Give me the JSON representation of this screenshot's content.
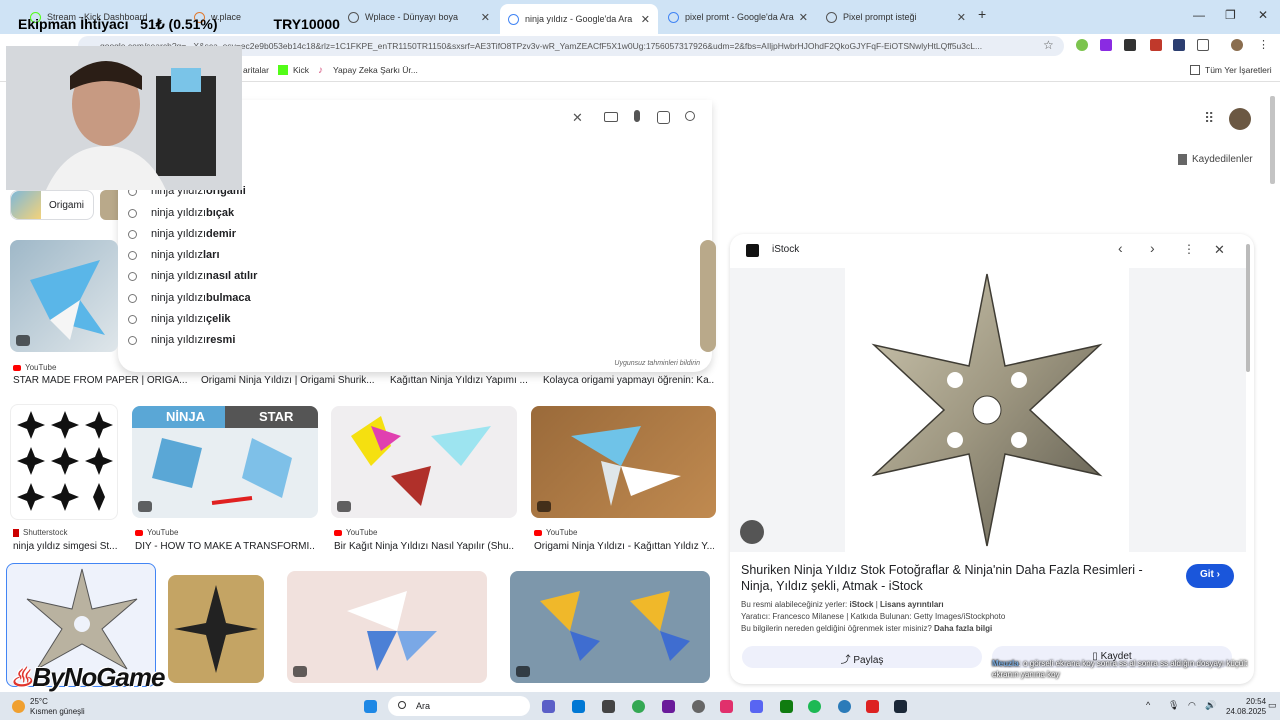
{
  "tabs": [
    {
      "title": "Stream - Kick Dashboard",
      "active": false
    },
    {
      "title": "w.place",
      "active": false
    },
    {
      "title": "Wplace - Dünyayı boya",
      "active": false
    },
    {
      "title": "ninja yıldız - Google'da Ara",
      "active": true
    },
    {
      "title": "pixel promt - Google'da Ara",
      "active": false
    },
    {
      "title": "Pixel prompt isteği",
      "active": false
    }
  ],
  "overlay": {
    "goal_label": "Ekipman İhtiyacı",
    "goal_progress": "51₺ (0.51%)",
    "goal_target": "TRY10000"
  },
  "address": {
    "url": "google.com/search?q=...X&sca_esv=ec2e9b053eb14c18&rlz=1C1FKPE_enTR1150TR1150&sxsrf=AE3TifO8TPzv3v-wR_YamZEACfF5X1w0Ug:1756057317926&udm=2&fbs=AIljpHwbrHJOhdF2QkoGJYFqF-EiOTSNwlyHtLQff5u3cL..."
  },
  "bookmarks": {
    "items": [
      "aritalar",
      "Kick",
      "Yapay Zeka Şarkı Ür..."
    ],
    "all_label": "Tüm Yer İşaretleri"
  },
  "google": {
    "saved_label": "Kaydedilenler",
    "filter_chip": "Origami",
    "suggestions": [
      {
        "base": "ninja yıldızı ",
        "bold": "origami"
      },
      {
        "base": "ninja yıldızı ",
        "bold": "bıçak"
      },
      {
        "base": "ninja yıldızı ",
        "bold": "demir"
      },
      {
        "base": "ninja yıldız",
        "bold": "ları"
      },
      {
        "base": "ninja yıldızı ",
        "bold": "nasıl atılır"
      },
      {
        "base": "ninja yıldızı ",
        "bold": "bulmaca"
      },
      {
        "base": "ninja yıldızı ",
        "bold": "çelik"
      },
      {
        "base": "ninja yıldızı ",
        "bold": "resmi"
      }
    ],
    "report_label": "Uygunsuz tahminleri bildirin"
  },
  "row1": [
    {
      "source": "YouTube",
      "title": "STAR MADE FROM PAPER | ORIGA..."
    },
    {
      "source": "",
      "title": "Origami Ninja Yıldızı | Origami Shurik..."
    },
    {
      "source": "",
      "title": "Kağıttan Ninja Yıldızı Yapımı ..."
    },
    {
      "source": "",
      "title": "Kolayca origami yapmayı öğrenin: Ka..."
    }
  ],
  "row2": [
    {
      "source": "Shutterstock",
      "title": "ninja yıldız simgesi St..."
    },
    {
      "source": "YouTube",
      "title": "DIY - HOW TO MAKE A TRANSFORMI...",
      "overlay_left": "NİNJA",
      "overlay_right": "STAR"
    },
    {
      "source": "YouTube",
      "title": "Bir Kağıt Ninja Yıldızı Nasıl Yapılır (Shu..."
    },
    {
      "source": "YouTube",
      "title": "Origami Ninja Yıldızı - Kağıttan Yıldız Y..."
    }
  ],
  "panel": {
    "source": "iStock",
    "title": "Shuriken Ninja Yıldız Stok Fotoğraflar & Ninja'nin Daha Fazla Resimleri - Ninja, Yıldız şekli, Atmak - iStock",
    "visit_label": "Git",
    "license_prefix": "Bu resmi alabileceğiniz yerler: ",
    "license_source": "iStock",
    "license_link": "Lisans ayrıntıları",
    "credit": "Yaratıcı: Francesco Milanese | Katkıda Bulunan: Getty Images/iStockphoto",
    "learn_prefix": "Bu bilgilerin nereden geldiğini öğrenmek ister misiniz? ",
    "learn_link": "Daha fazla bilgi",
    "share_label": "Paylaş",
    "save_label": "Kaydet"
  },
  "chat_overlay": {
    "user": "Meuzla",
    "message": ": o görseli ekrana koy sonra ss al sonra ss aldığın dosyayı küçült ekranın yanına koy"
  },
  "logo_text": "ByNoGame",
  "taskbar": {
    "weather_temp": "25°C",
    "weather_desc": "Kısmen güneşli",
    "search_label": "Ara",
    "time": "20:54",
    "date": "24.08.2025"
  }
}
